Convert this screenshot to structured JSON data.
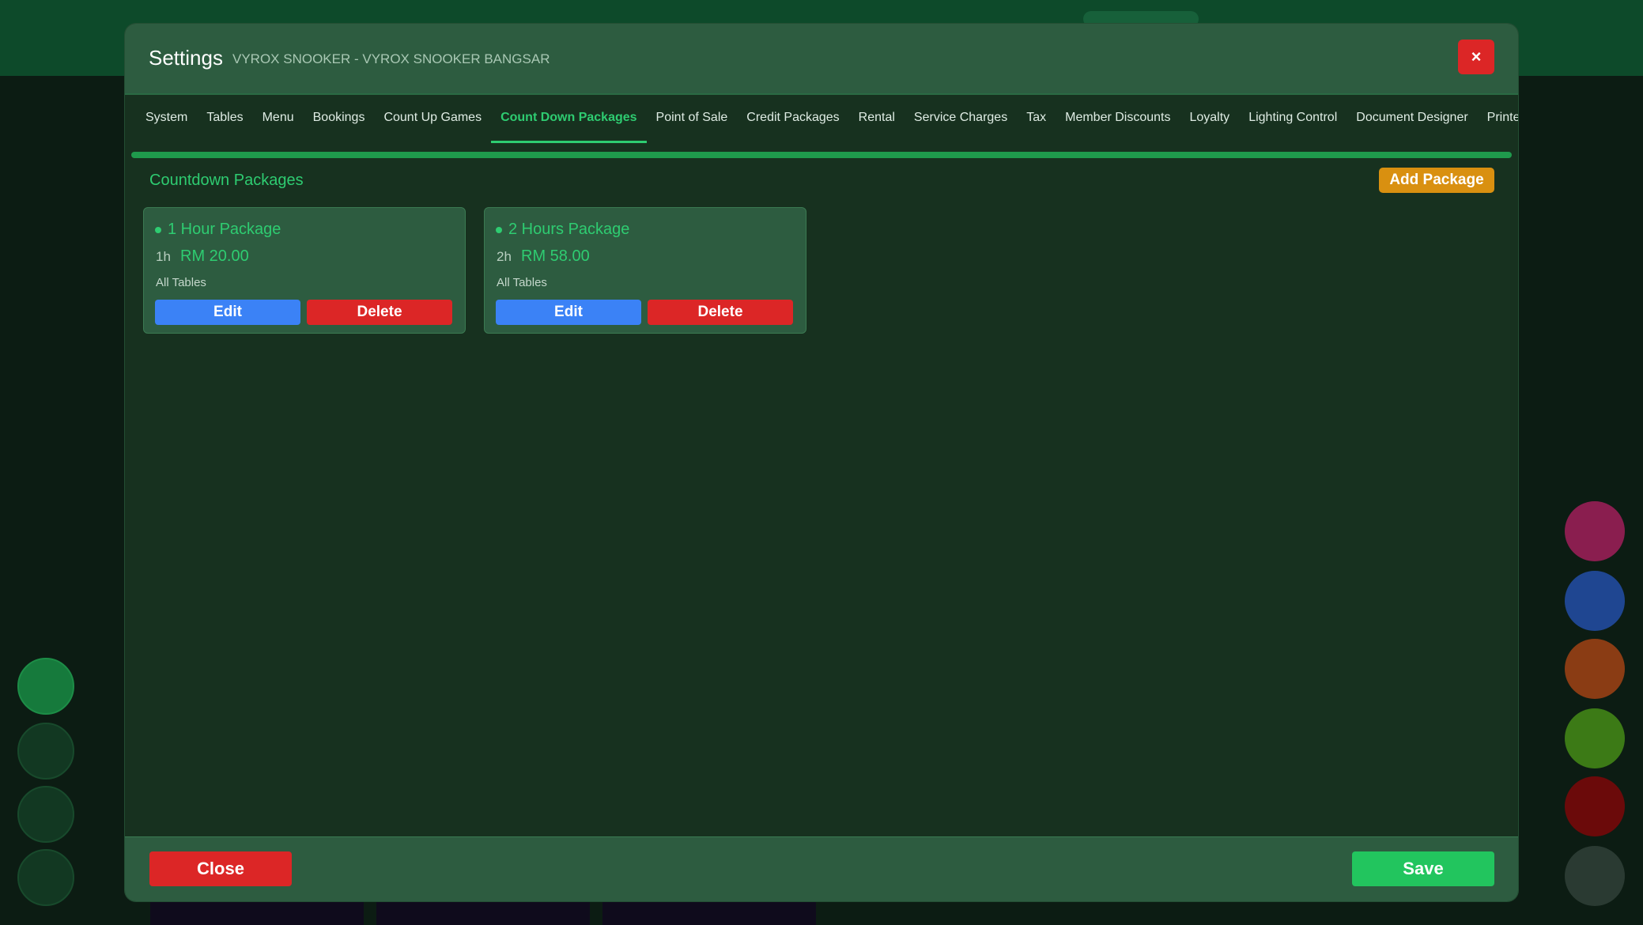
{
  "modal": {
    "title": "Settings",
    "subtitle": "VYROX SNOOKER - VYROX SNOOKER BANGSAR",
    "close_icon": "×"
  },
  "tabs": [
    {
      "label": "System",
      "active": false
    },
    {
      "label": "Tables",
      "active": false
    },
    {
      "label": "Menu",
      "active": false
    },
    {
      "label": "Bookings",
      "active": false
    },
    {
      "label": "Count Up Games",
      "active": false
    },
    {
      "label": "Count Down Packages",
      "active": true
    },
    {
      "label": "Point of Sale",
      "active": false
    },
    {
      "label": "Credit Packages",
      "active": false
    },
    {
      "label": "Rental",
      "active": false
    },
    {
      "label": "Service Charges",
      "active": false
    },
    {
      "label": "Tax",
      "active": false
    },
    {
      "label": "Member Discounts",
      "active": false
    },
    {
      "label": "Loyalty",
      "active": false
    },
    {
      "label": "Lighting Control",
      "active": false
    },
    {
      "label": "Document Designer",
      "active": false
    },
    {
      "label": "Printers",
      "active": false
    }
  ],
  "section": {
    "title": "Countdown Packages",
    "add_label": "Add Package"
  },
  "packages": [
    {
      "name": "1 Hour Package",
      "duration": "1h",
      "price": "RM 20.00",
      "tables": "All Tables",
      "edit_label": "Edit",
      "delete_label": "Delete"
    },
    {
      "name": "2 Hours Package",
      "duration": "2h",
      "price": "RM 58.00",
      "tables": "All Tables",
      "edit_label": "Edit",
      "delete_label": "Delete"
    }
  ],
  "footer": {
    "close_label": "Close",
    "save_label": "Save"
  },
  "colors": {
    "accent": "#2ecc71",
    "danger": "#dc2626",
    "primary": "#3b82f6",
    "warning": "#d99010",
    "success": "#22c55e"
  }
}
